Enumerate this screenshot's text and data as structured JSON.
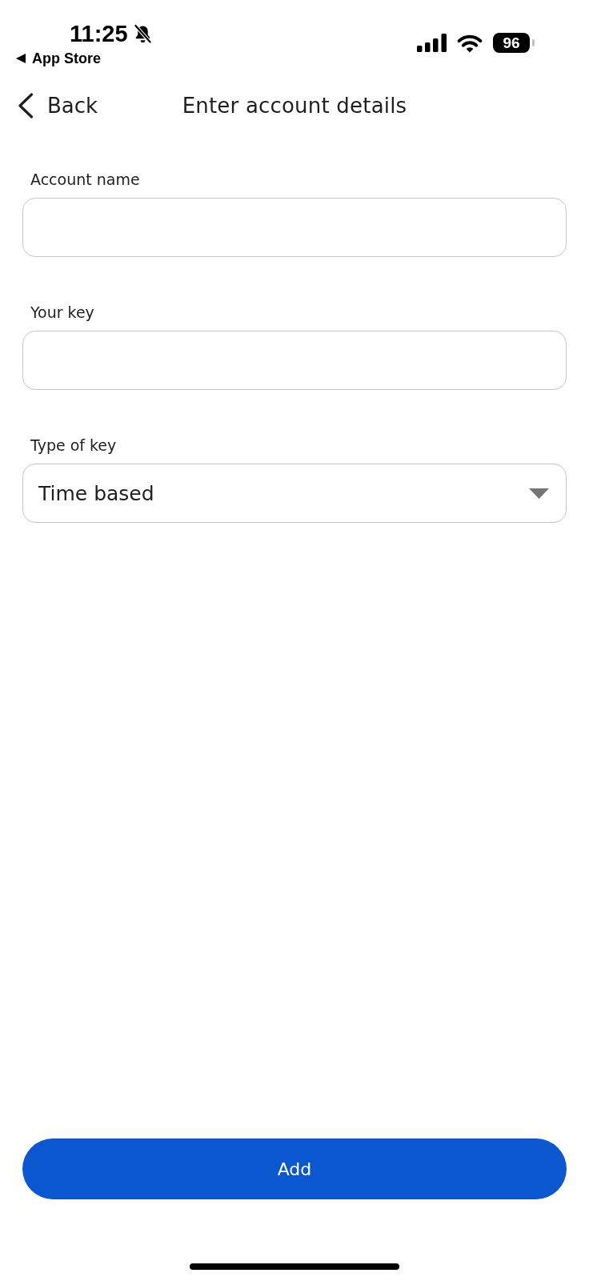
{
  "status_bar": {
    "time": "11:25",
    "silent": true,
    "back_to_app": "App Store",
    "battery": "96"
  },
  "nav": {
    "back": "Back",
    "title": "Enter account details"
  },
  "fields": [
    {
      "kind": "text",
      "label": "Account name"
    },
    {
      "kind": "text",
      "label": "Your key"
    },
    {
      "kind": "dropdown",
      "label": "Type of key",
      "value": "Time based"
    }
  ],
  "primary_button": {
    "label": "Add"
  }
}
